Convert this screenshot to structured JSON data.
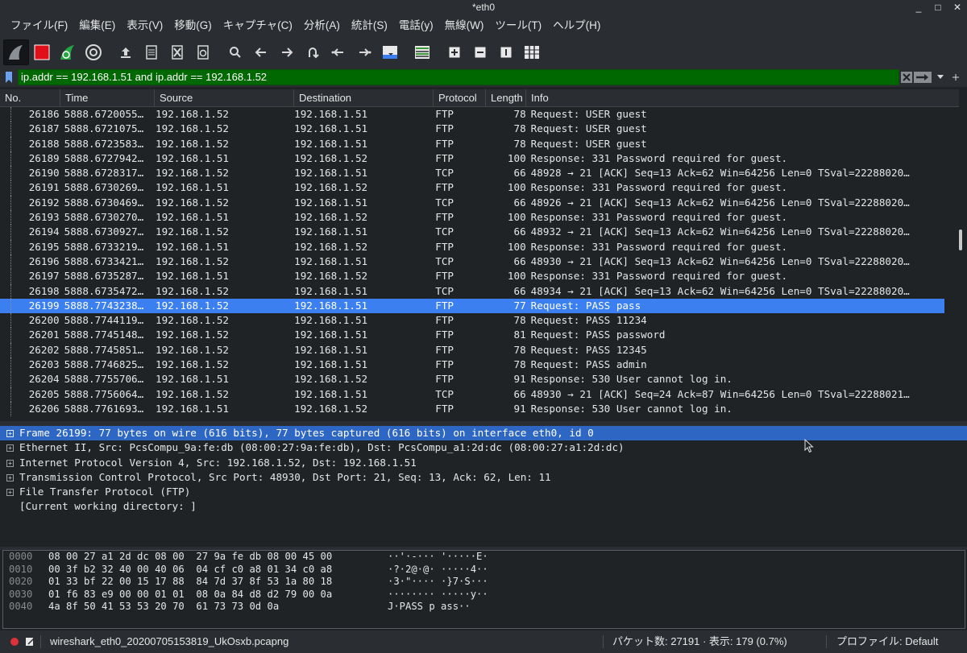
{
  "window": {
    "title": "*eth0",
    "controls": [
      "_",
      "□",
      "✕"
    ]
  },
  "menu": [
    "ファイル(F)",
    "編集(E)",
    "表示(V)",
    "移動(G)",
    "キャプチャ(C)",
    "分析(A)",
    "統計(S)",
    "電話(y)",
    "無線(W)",
    "ツール(T)",
    "ヘルプ(H)"
  ],
  "filter": {
    "value": "ip.addr == 192.168.1.51 and ip.addr == 192.168.1.52"
  },
  "packet_list": {
    "columns": [
      "No.",
      "Time",
      "Source",
      "Destination",
      "Protocol",
      "Length",
      "Info"
    ],
    "rows": [
      {
        "no": "26186",
        "time": "5888.6720055…",
        "src": "192.168.1.52",
        "dst": "192.168.1.51",
        "proto": "FTP",
        "len": "78",
        "info": "Request: USER guest"
      },
      {
        "no": "26187",
        "time": "5888.6721075…",
        "src": "192.168.1.52",
        "dst": "192.168.1.51",
        "proto": "FTP",
        "len": "78",
        "info": "Request: USER guest"
      },
      {
        "no": "26188",
        "time": "5888.6723583…",
        "src": "192.168.1.52",
        "dst": "192.168.1.51",
        "proto": "FTP",
        "len": "78",
        "info": "Request: USER guest"
      },
      {
        "no": "26189",
        "time": "5888.6727942…",
        "src": "192.168.1.51",
        "dst": "192.168.1.52",
        "proto": "FTP",
        "len": "100",
        "info": "Response: 331 Password required for guest."
      },
      {
        "no": "26190",
        "time": "5888.6728317…",
        "src": "192.168.1.52",
        "dst": "192.168.1.51",
        "proto": "TCP",
        "len": "66",
        "info": "48928 → 21 [ACK] Seq=13 Ack=62 Win=64256 Len=0 TSval=22288020…"
      },
      {
        "no": "26191",
        "time": "5888.6730269…",
        "src": "192.168.1.51",
        "dst": "192.168.1.52",
        "proto": "FTP",
        "len": "100",
        "info": "Response: 331 Password required for guest."
      },
      {
        "no": "26192",
        "time": "5888.6730469…",
        "src": "192.168.1.52",
        "dst": "192.168.1.51",
        "proto": "TCP",
        "len": "66",
        "info": "48926 → 21 [ACK] Seq=13 Ack=62 Win=64256 Len=0 TSval=22288020…"
      },
      {
        "no": "26193",
        "time": "5888.6730270…",
        "src": "192.168.1.51",
        "dst": "192.168.1.52",
        "proto": "FTP",
        "len": "100",
        "info": "Response: 331 Password required for guest."
      },
      {
        "no": "26194",
        "time": "5888.6730927…",
        "src": "192.168.1.52",
        "dst": "192.168.1.51",
        "proto": "TCP",
        "len": "66",
        "info": "48932 → 21 [ACK] Seq=13 Ack=62 Win=64256 Len=0 TSval=22288020…"
      },
      {
        "no": "26195",
        "time": "5888.6733219…",
        "src": "192.168.1.51",
        "dst": "192.168.1.52",
        "proto": "FTP",
        "len": "100",
        "info": "Response: 331 Password required for guest."
      },
      {
        "no": "26196",
        "time": "5888.6733421…",
        "src": "192.168.1.52",
        "dst": "192.168.1.51",
        "proto": "TCP",
        "len": "66",
        "info": "48930 → 21 [ACK] Seq=13 Ack=62 Win=64256 Len=0 TSval=22288020…"
      },
      {
        "no": "26197",
        "time": "5888.6735287…",
        "src": "192.168.1.51",
        "dst": "192.168.1.52",
        "proto": "FTP",
        "len": "100",
        "info": "Response: 331 Password required for guest."
      },
      {
        "no": "26198",
        "time": "5888.6735472…",
        "src": "192.168.1.52",
        "dst": "192.168.1.51",
        "proto": "TCP",
        "len": "66",
        "info": "48934 → 21 [ACK] Seq=13 Ack=62 Win=64256 Len=0 TSval=22288020…"
      },
      {
        "no": "26199",
        "time": "5888.7743238…",
        "src": "192.168.1.52",
        "dst": "192.168.1.51",
        "proto": "FTP",
        "len": "77",
        "info": "Request: PASS pass"
      },
      {
        "no": "26200",
        "time": "5888.7744119…",
        "src": "192.168.1.52",
        "dst": "192.168.1.51",
        "proto": "FTP",
        "len": "78",
        "info": "Request: PASS 11234"
      },
      {
        "no": "26201",
        "time": "5888.7745148…",
        "src": "192.168.1.52",
        "dst": "192.168.1.51",
        "proto": "FTP",
        "len": "81",
        "info": "Request: PASS password"
      },
      {
        "no": "26202",
        "time": "5888.7745851…",
        "src": "192.168.1.52",
        "dst": "192.168.1.51",
        "proto": "FTP",
        "len": "78",
        "info": "Request: PASS 12345"
      },
      {
        "no": "26203",
        "time": "5888.7746825…",
        "src": "192.168.1.52",
        "dst": "192.168.1.51",
        "proto": "FTP",
        "len": "78",
        "info": "Request: PASS admin"
      },
      {
        "no": "26204",
        "time": "5888.7755706…",
        "src": "192.168.1.51",
        "dst": "192.168.1.52",
        "proto": "FTP",
        "len": "91",
        "info": "Response: 530 User cannot log in."
      },
      {
        "no": "26205",
        "time": "5888.7756064…",
        "src": "192.168.1.52",
        "dst": "192.168.1.51",
        "proto": "TCP",
        "len": "66",
        "info": "48930 → 21 [ACK] Seq=24 Ack=87 Win=64256 Len=0 TSval=22288021…"
      },
      {
        "no": "26206",
        "time": "5888.7761693…",
        "src": "192.168.1.51",
        "dst": "192.168.1.52",
        "proto": "FTP",
        "len": "91",
        "info": "Response: 530 User cannot log in."
      }
    ],
    "selected_no": "26199"
  },
  "details": [
    {
      "text": "Frame 26199: 77 bytes on wire (616 bits), 77 bytes captured (616 bits) on interface eth0, id 0",
      "expandable": true,
      "selected": true
    },
    {
      "text": "Ethernet II, Src: PcsCompu_9a:fe:db (08:00:27:9a:fe:db), Dst: PcsCompu_a1:2d:dc (08:00:27:a1:2d:dc)",
      "expandable": true,
      "selected": false
    },
    {
      "text": "Internet Protocol Version 4, Src: 192.168.1.52, Dst: 192.168.1.51",
      "expandable": true,
      "selected": false
    },
    {
      "text": "Transmission Control Protocol, Src Port: 48930, Dst Port: 21, Seq: 13, Ack: 62, Len: 11",
      "expandable": true,
      "selected": false
    },
    {
      "text": "File Transfer Protocol (FTP)",
      "expandable": true,
      "selected": false
    },
    {
      "text": "[Current working directory: ]",
      "expandable": false,
      "selected": false
    }
  ],
  "bytes": [
    {
      "off": "0000",
      "hex": "08 00 27 a1 2d dc 08 00  27 9a fe db 08 00 45 00",
      "ascii": "··'·-··· '·····E·"
    },
    {
      "off": "0010",
      "hex": "00 3f b2 32 40 00 40 06  04 cf c0 a8 01 34 c0 a8",
      "ascii": "·?·2@·@· ·····4··"
    },
    {
      "off": "0020",
      "hex": "01 33 bf 22 00 15 17 88  84 7d 37 8f 53 1a 80 18",
      "ascii": "·3·\"···· ·}7·S···"
    },
    {
      "off": "0030",
      "hex": "01 f6 83 e9 00 00 01 01  08 0a 84 d8 d2 79 00 0a",
      "ascii": "········ ·····y··"
    },
    {
      "off": "0040",
      "hex": "4a 8f 50 41 53 53 20 70  61 73 73 0d 0a",
      "ascii": "J·PASS p ass··"
    }
  ],
  "status": {
    "file": "wireshark_eth0_20200705153819_UkOsxb.pcapng",
    "packets": "パケット数: 27191 · 表示: 179 (0.7%)",
    "profile": "プロファイル: Default"
  },
  "colors": {
    "selected_row": "#3b7ff0",
    "filter_bg": "#006800",
    "bg": "#1f2326",
    "chrome": "#2a2e32"
  }
}
